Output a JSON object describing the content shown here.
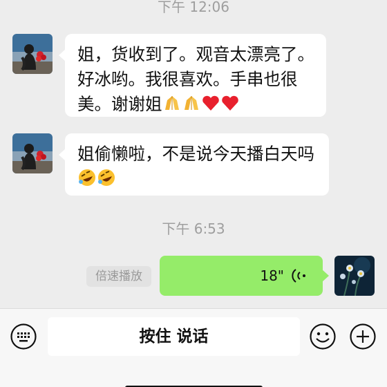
{
  "chat": {
    "timestamp_1": "下午 12:06",
    "message_1": "姐，货收到了。观音太漂亮了。好冰哟。我很喜欢。手串也很美。谢谢姐",
    "message_1_emojis": [
      "folded-hands",
      "folded-hands",
      "red-heart",
      "red-heart"
    ],
    "message_2": "姐偷懒啦，不是说今天播白天吗",
    "message_2_emojis": [
      "rolling-laughing",
      "rolling-laughing"
    ],
    "timestamp_2": "下午 6:53",
    "voice_duration": "18\"",
    "speed_play_label": "倍速播放"
  },
  "input_bar": {
    "hold_to_talk_label": "按住 说话"
  },
  "colors": {
    "background": "#ededed",
    "incoming_bubble": "#ffffff",
    "outgoing_bubble": "#95ec69"
  }
}
